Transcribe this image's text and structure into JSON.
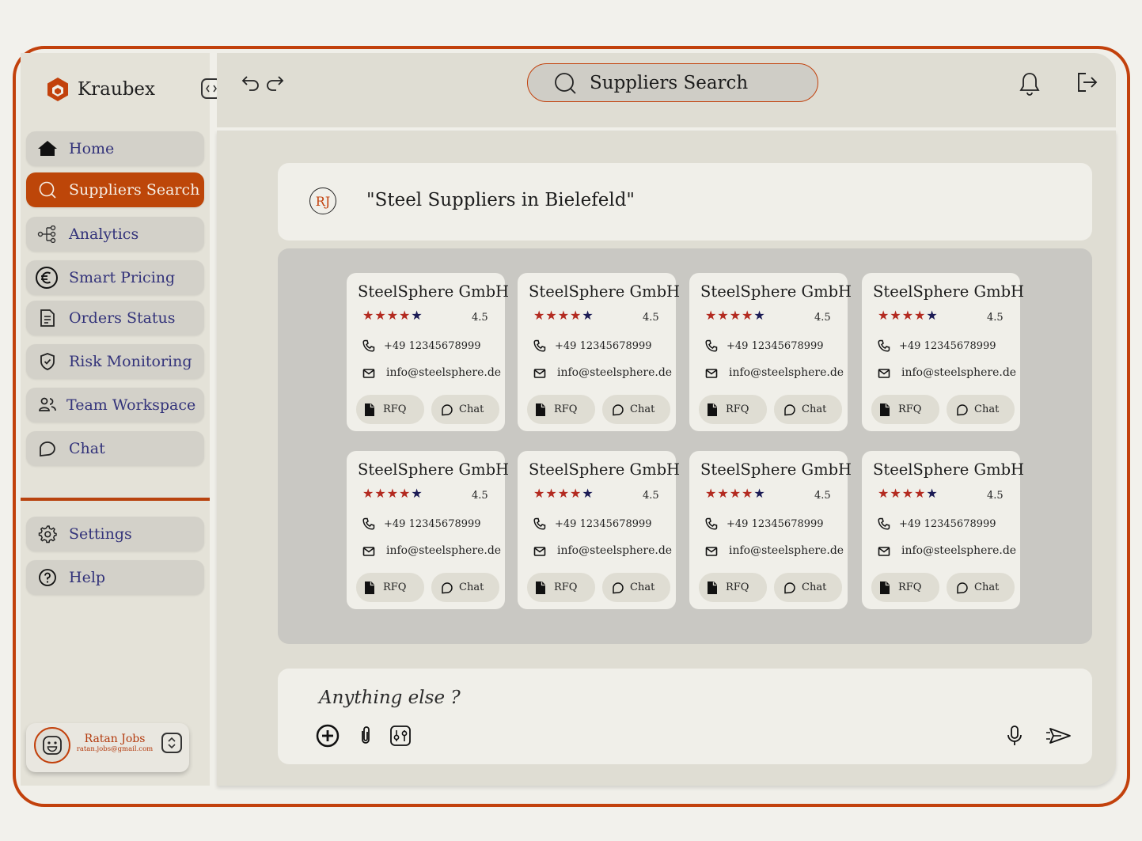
{
  "brand": {
    "name": "Kraubex",
    "accent": "#c2410c"
  },
  "nav": {
    "items": [
      {
        "label": "Home",
        "icon": "home-icon",
        "active": false
      },
      {
        "label": "Suppliers Search",
        "icon": "search-icon",
        "active": true
      },
      {
        "label": "Analytics",
        "icon": "analytics-icon",
        "active": false
      },
      {
        "label": "Smart Pricing",
        "icon": "euro-icon",
        "active": false
      },
      {
        "label": "Orders Status",
        "icon": "document-icon",
        "active": false
      },
      {
        "label": "Risk Monitoring",
        "icon": "shield-icon",
        "active": false
      },
      {
        "label": "Team Workspace",
        "icon": "users-icon",
        "active": false
      },
      {
        "label": "Chat",
        "icon": "chat-icon",
        "active": false
      }
    ],
    "footer_items": [
      {
        "label": "Settings",
        "icon": "gear-icon"
      },
      {
        "label": "Help",
        "icon": "help-icon"
      }
    ]
  },
  "user": {
    "name": "Ratan Jobs",
    "email": "ratan.jobs@gmail.com"
  },
  "header": {
    "search_label": "Suppliers Search"
  },
  "query": {
    "initials": "RJ",
    "text": "\"Steel Suppliers in Bielefeld\""
  },
  "results": [
    {
      "name": "SteelSphere GmbH",
      "rating": "4.5",
      "stars_filled": 4,
      "phone": "+49 12345678999",
      "email": "info@steelsphere.de",
      "rfq_label": "RFQ",
      "chat_label": "Chat"
    },
    {
      "name": "SteelSphere GmbH",
      "rating": "4.5",
      "stars_filled": 4,
      "phone": "+49 12345678999",
      "email": "info@steelsphere.de",
      "rfq_label": "RFQ",
      "chat_label": "Chat"
    },
    {
      "name": "SteelSphere GmbH",
      "rating": "4.5",
      "stars_filled": 4,
      "phone": "+49 12345678999",
      "email": "info@steelsphere.de",
      "rfq_label": "RFQ",
      "chat_label": "Chat"
    },
    {
      "name": "SteelSphere GmbH",
      "rating": "4.5",
      "stars_filled": 4,
      "phone": "+49 12345678999",
      "email": "info@steelsphere.de",
      "rfq_label": "RFQ",
      "chat_label": "Chat"
    },
    {
      "name": "SteelSphere GmbH",
      "rating": "4.5",
      "stars_filled": 4,
      "phone": "+49 12345678999",
      "email": "info@steelsphere.de",
      "rfq_label": "RFQ",
      "chat_label": "Chat"
    },
    {
      "name": "SteelSphere GmbH",
      "rating": "4.5",
      "stars_filled": 4,
      "phone": "+49 12345678999",
      "email": "info@steelsphere.de",
      "rfq_label": "RFQ",
      "chat_label": "Chat"
    },
    {
      "name": "SteelSphere GmbH",
      "rating": "4.5",
      "stars_filled": 4,
      "phone": "+49 12345678999",
      "email": "info@steelsphere.de",
      "rfq_label": "RFQ",
      "chat_label": "Chat"
    },
    {
      "name": "SteelSphere GmbH",
      "rating": "4.5",
      "stars_filled": 4,
      "phone": "+49 12345678999",
      "email": "info@steelsphere.de",
      "rfq_label": "RFQ",
      "chat_label": "Chat"
    }
  ],
  "composer": {
    "placeholder": "Anything else ?"
  },
  "colors": {
    "active_nav": "#bd4609",
    "star": "#b32a20",
    "star_empty": "#1b1b55",
    "nav_text": "#33337a"
  }
}
